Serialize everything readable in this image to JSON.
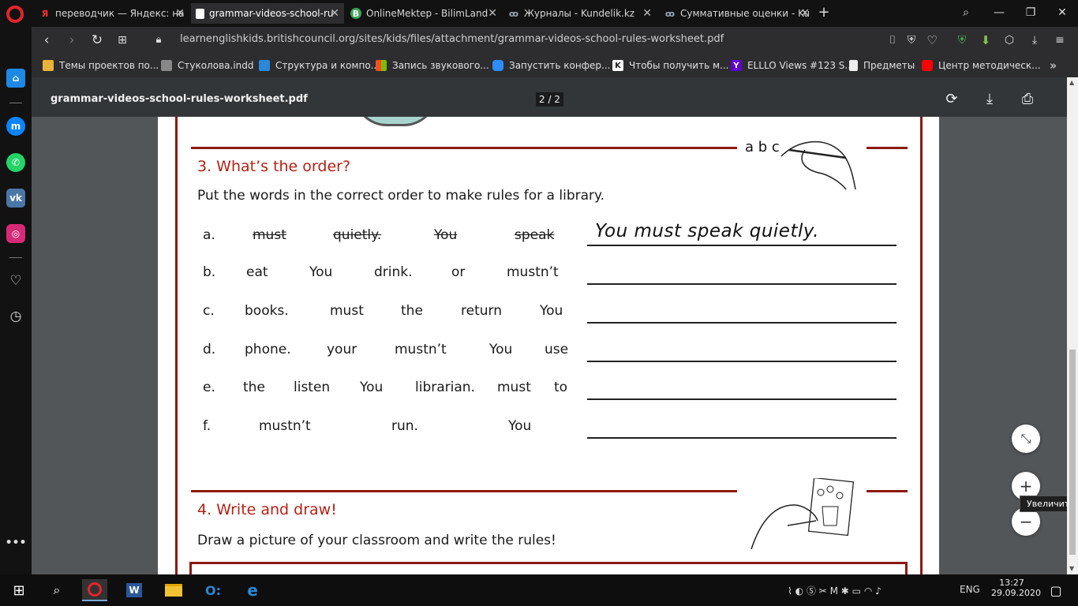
{
  "tabs": [
    {
      "label": "переводчик — Яндекс: на",
      "icon": "yandex-icon"
    },
    {
      "label": "grammar-videos-school-ru",
      "icon": "document-icon",
      "active": true
    },
    {
      "label": "OnlineMektep - BilimLand",
      "icon": "bilimland-icon"
    },
    {
      "label": "Журналы - Kundelik.kz",
      "icon": "kundelik-icon"
    },
    {
      "label": "Суммативные оценки - Ku",
      "icon": "kundelik-icon"
    }
  ],
  "address": {
    "url": "learnenglishkids.britishcouncil.org/sites/kids/files/attachment/grammar-videos-school-rules-worksheet.pdf"
  },
  "bookmarks": [
    {
      "label": "Темы проектов по...",
      "icon": "folder-icon",
      "color": "#e8b339"
    },
    {
      "label": "Стуколова.indd",
      "icon": "attachment-icon",
      "color": "#888888"
    },
    {
      "label": "Структура и компо...",
      "icon": "cube-icon",
      "color": "#2b88d8"
    },
    {
      "label": "Запись звукового...",
      "icon": "windows-icon",
      "color": "#f25022"
    },
    {
      "label": "Запустить конфер...",
      "icon": "zoom-icon",
      "color": "#2d8cff"
    },
    {
      "label": "Чтобы получить м...",
      "icon": "k-icon",
      "color": "#222222"
    },
    {
      "label": "ELLLO Views #123 S...",
      "icon": "yahoo-icon",
      "color": "#6001d2"
    },
    {
      "label": "Предметы",
      "icon": "page-icon",
      "color": "#eeeeee"
    },
    {
      "label": "Центр методическ...",
      "icon": "youtube-icon",
      "color": "#ff0000"
    }
  ],
  "pdf": {
    "filename": "grammar-videos-school-rules-worksheet.pdf",
    "page_indicator": "2 / 2"
  },
  "worksheet": {
    "section3": {
      "title": "3. What’s the order?",
      "instruction": "Put the words in the correct order to make rules for a library.",
      "abc": "a b c",
      "rows": [
        {
          "label": "a.",
          "words": [
            "must",
            "quietly.",
            "You",
            "speak"
          ],
          "answer": "You must speak quietly.",
          "struck": true
        },
        {
          "label": "b.",
          "words": [
            "eat",
            "You",
            "drink.",
            "or",
            "mustn’t"
          ],
          "answer": ""
        },
        {
          "label": "c.",
          "words": [
            "books.",
            "must",
            "the",
            "return",
            "You"
          ],
          "answer": ""
        },
        {
          "label": "d.",
          "words": [
            "phone.",
            "your",
            "mustn’t",
            "You",
            "use"
          ],
          "answer": ""
        },
        {
          "label": "e.",
          "words": [
            "the",
            "listen",
            "You",
            "librarian.",
            "must",
            "to"
          ],
          "answer": ""
        },
        {
          "label": "f.",
          "words": [
            "mustn’t",
            "run.",
            "You"
          ],
          "answer": ""
        }
      ]
    },
    "section4": {
      "title": "4. Write and draw!",
      "instruction": "Draw a picture of your classroom and write the rules!"
    }
  },
  "zoom_tooltip": "Увеличить",
  "taskbar": {
    "lang": "ENG",
    "time": "13:27",
    "date": "29.09.2020"
  }
}
